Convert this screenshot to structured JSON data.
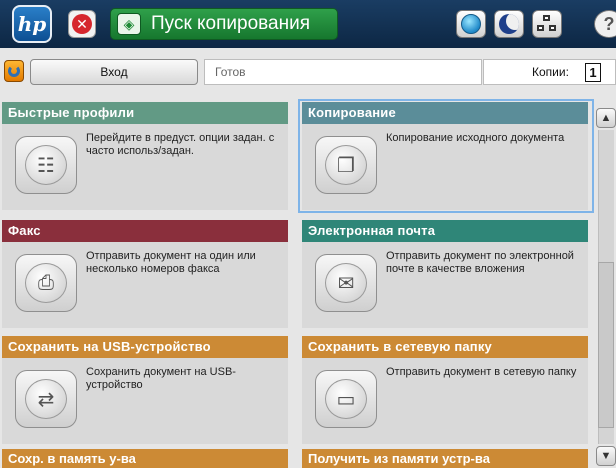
{
  "topbar": {
    "logo_text": "hp",
    "start_copy_label": "Пуск копирования"
  },
  "status": {
    "login_label": "Вход",
    "state_text": "Готов",
    "copies_label": "Копии:",
    "copies_value": "1"
  },
  "tiles": [
    {
      "title": "Быстрые профили",
      "desc": "Перейдите в предуст. опции задан. с часто использ/задан.",
      "icon": "clipboard-icon",
      "color": "#629a85"
    },
    {
      "title": "Копирование",
      "desc": "Копирование исходного документа",
      "icon": "copy-documents-icon",
      "color": "#5b8d99"
    },
    {
      "title": "Факс",
      "desc": "Отправить документ на один или несколько номеров факса",
      "icon": "fax-icon",
      "color": "#8a2f3c"
    },
    {
      "title": "Электронная почта",
      "desc": "Отправить документ по электронной почте в качестве вложения",
      "icon": "envelope-icon",
      "color": "#2f8678"
    },
    {
      "title": "Сохранить на USB-устройство",
      "desc": "Сохранить документ на USB-устройство",
      "icon": "usb-icon",
      "color": "#cc8a35"
    },
    {
      "title": "Сохранить в сетевую папку",
      "desc": "Отправить документ в сетевую папку",
      "icon": "folder-icon",
      "color": "#cc8a35"
    }
  ],
  "bottom": {
    "left_title": "Сохр. в память у-ва",
    "right_title": "Получить из памяти устр-ва"
  }
}
